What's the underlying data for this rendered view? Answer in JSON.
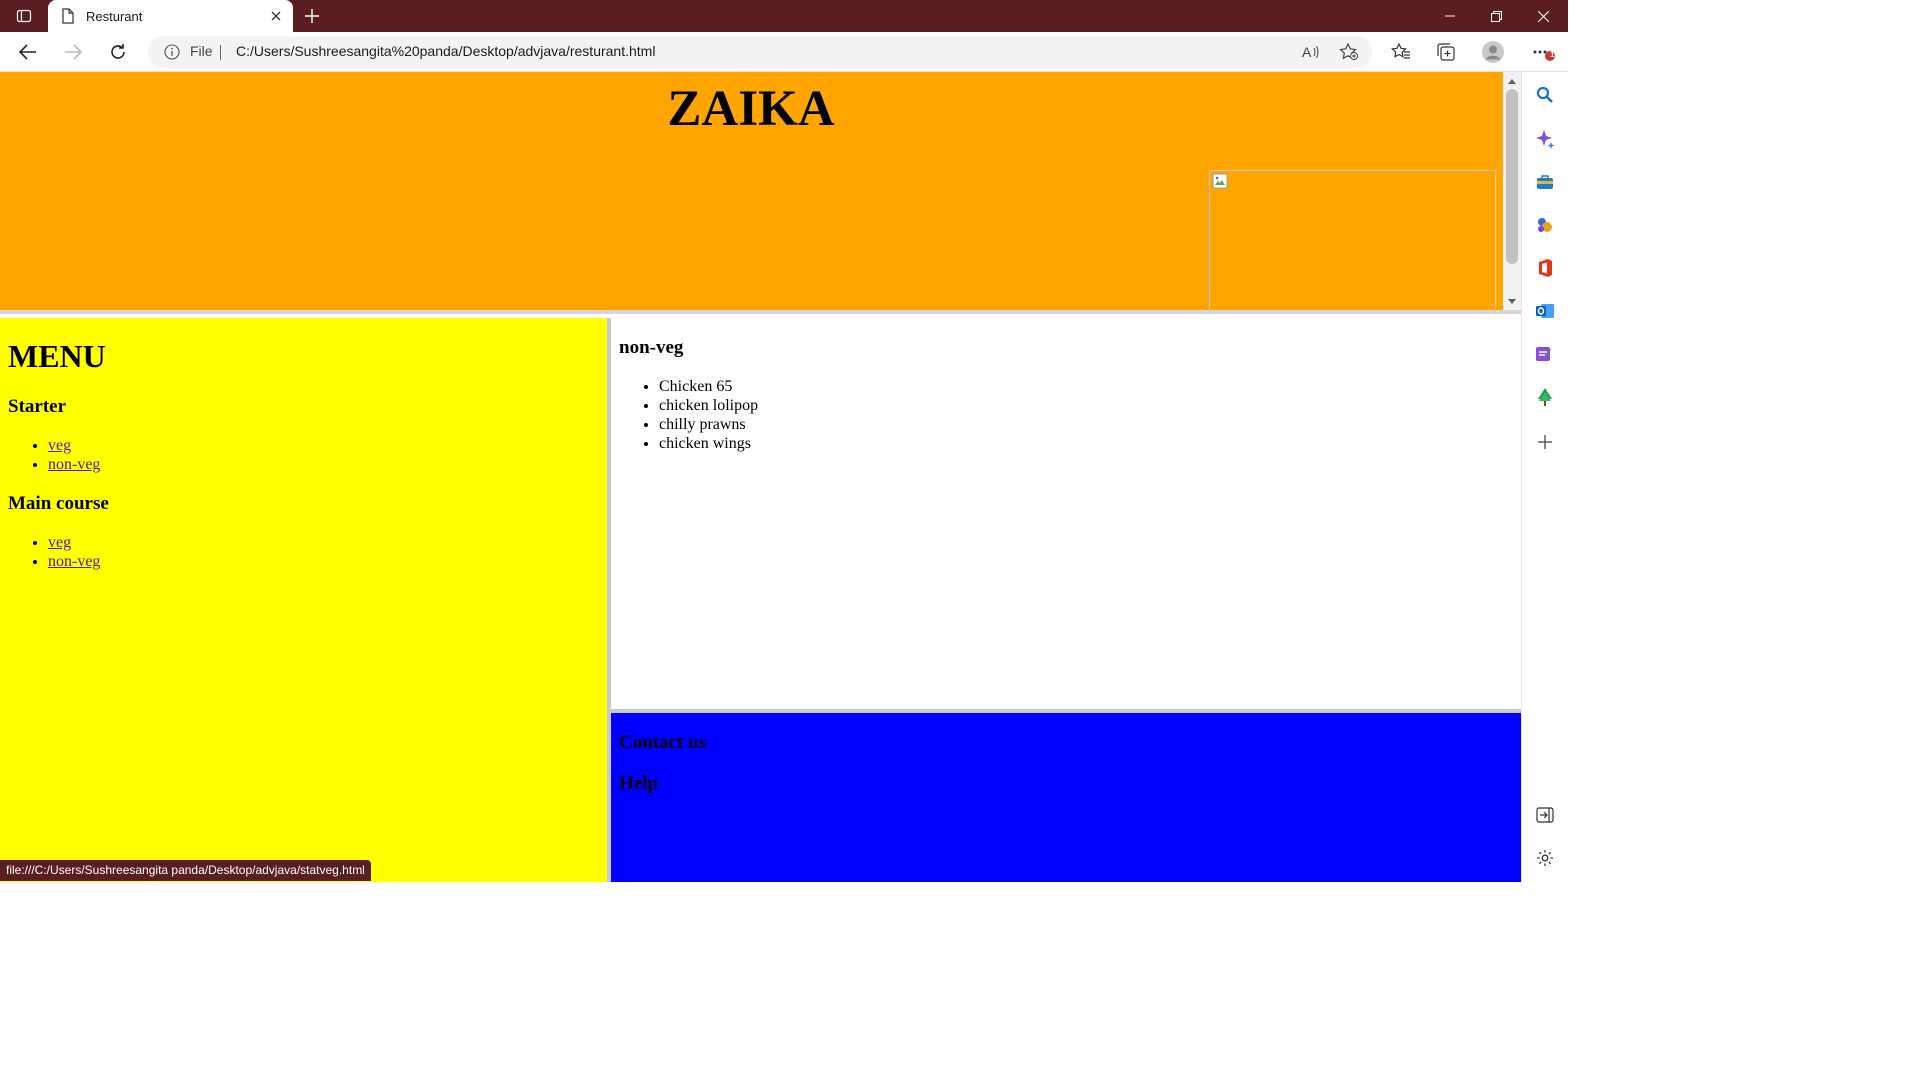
{
  "browser": {
    "tab_title": "Resturant",
    "address_scheme": "File",
    "address_url": "C:/Users/Sushreesangita%20panda/Desktop/advjava/resturant.html",
    "status_url": "file:///C:/Users/Sushreesangita panda/Desktop/advjava/statveg.html",
    "notification_badge": "1",
    "toolbar_icons": [
      "back-icon",
      "forward-icon",
      "refresh-icon",
      "read-aloud-icon",
      "add-favorite-icon",
      "favorites-icon",
      "collections-icon",
      "profile-icon",
      "more-icon"
    ],
    "sidebar_icons": [
      "search-icon",
      "copilot-icon",
      "shopping-icon",
      "games-icon",
      "office-icon",
      "outlook-icon",
      "designer-icon",
      "tree-icon",
      "add-icon",
      "hide-sidebar-icon",
      "settings-icon"
    ]
  },
  "colors": {
    "titlebar": "#5a1e22",
    "header_frame": "#ffa500",
    "menu_frame": "#ffff00",
    "content_frame": "#ffffff",
    "footer_frame": "#0000ff",
    "visited_link": "#551a8b"
  },
  "header": {
    "title": "ZAIKA"
  },
  "menu": {
    "heading": "MENU",
    "sections": [
      {
        "title": "Starter",
        "links": [
          "veg",
          "non-veg"
        ]
      },
      {
        "title": "Main course",
        "links": [
          "veg",
          "non-veg"
        ]
      }
    ]
  },
  "content": {
    "heading": "non-veg",
    "items": [
      "Chicken 65",
      "chicken lolipop",
      "chilly prawns",
      "chicken wings"
    ]
  },
  "footer": {
    "links": [
      "Contact us",
      "Help"
    ]
  }
}
